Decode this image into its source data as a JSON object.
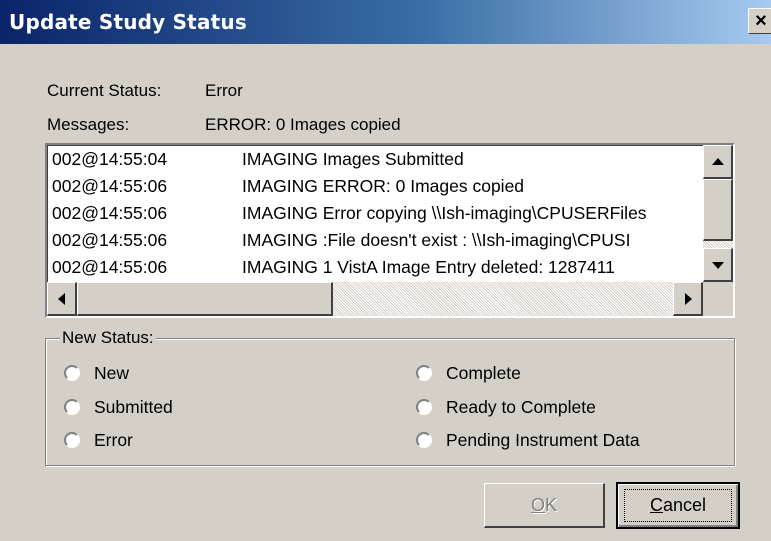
{
  "window": {
    "title": "Update Study Status",
    "close_glyph": "×"
  },
  "status": {
    "label": "Current Status:",
    "value": "Error"
  },
  "messages": {
    "label": "Messages:",
    "value": "ERROR: 0 Images copied",
    "rows": [
      {
        "time": "002@14:55:04",
        "text": "IMAGING Images Submitted"
      },
      {
        "time": "002@14:55:06",
        "text": "IMAGING ERROR: 0 Images copied"
      },
      {
        "time": "002@14:55:06",
        "text": "IMAGING Error copying \\\\Ish-imaging\\CPUSERFiles"
      },
      {
        "time": "002@14:55:06",
        "text": "IMAGING    :File doesn't exist : \\\\Ish-imaging\\CPUSI"
      },
      {
        "time": "002@14:55:06",
        "text": "IMAGING 1 VistA Image Entry deleted: 1287411"
      }
    ]
  },
  "new_status": {
    "legend": "New Status:",
    "options": [
      "New",
      "Submitted",
      "Error",
      "Complete",
      "Ready to Complete",
      "Pending Instrument Data"
    ]
  },
  "buttons": {
    "ok": {
      "accel": "O",
      "rest": "K",
      "enabled": false
    },
    "cancel": {
      "accel": "C",
      "rest": "ancel"
    }
  },
  "icons": {
    "scroll_up": "up-arrow-icon",
    "scroll_down": "down-arrow-icon",
    "scroll_left": "left-arrow-icon",
    "scroll_right": "right-arrow-icon"
  },
  "colors": {
    "title_gradient_start": "#0a246a",
    "title_gradient_end": "#a6caf0",
    "dialog_face": "#d4d0c8",
    "disabled_text": "#808080"
  }
}
